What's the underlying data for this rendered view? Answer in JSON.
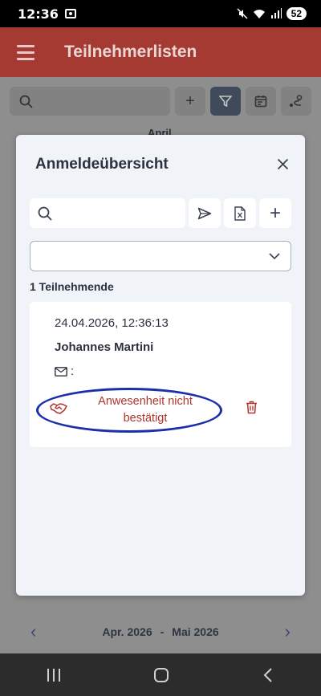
{
  "status_bar": {
    "time": "12:36",
    "battery": "52"
  },
  "app_bar": {
    "title": "Teilnehmerlisten"
  },
  "background": {
    "month_label": "April",
    "footer": {
      "from": "Apr. 2026",
      "separator": "-",
      "to": "Mai 2026",
      "prev": "‹",
      "next": "›"
    },
    "toolbar": {
      "add": "+"
    }
  },
  "modal": {
    "title": "Anmeldeübersicht",
    "search_placeholder": "",
    "search_value": "",
    "add": "+",
    "select_value": "",
    "count_label": "1 Teilnehmende",
    "entries": [
      {
        "timestamp": "24.04.2026, 12:36:13",
        "name": "Johannes Martini",
        "email_label": ":",
        "attendance_line1": "Anwesenheit nicht",
        "attendance_line2": "bestätigt"
      }
    ]
  },
  "colors": {
    "app_bar": "#a43a31",
    "attendance_text": "#b0342b",
    "highlight_ellipse": "#1b2fa8",
    "modal_bg": "#f0f3f7"
  }
}
